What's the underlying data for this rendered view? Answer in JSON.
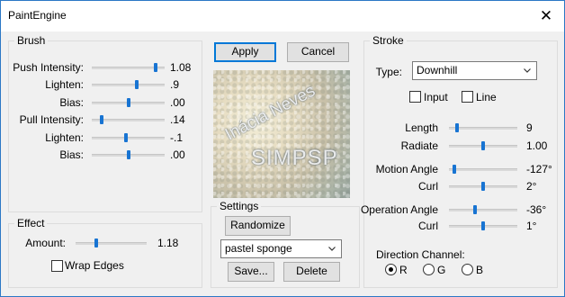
{
  "window": {
    "title": "PaintEngine",
    "close_glyph": "✕"
  },
  "buttons": {
    "apply": "Apply",
    "cancel": "Cancel",
    "randomize": "Randomize",
    "save": "Save...",
    "delete": "Delete"
  },
  "brush": {
    "title": "Brush",
    "rows": [
      {
        "label": "Push Intensity:",
        "value": "1.08",
        "level": 0.9
      },
      {
        "label": "Lighten:",
        "value": ".9",
        "level": 0.62
      },
      {
        "label": "Bias:",
        "value": ".00",
        "level": 0.5
      },
      {
        "label": "Pull Intensity:",
        "value": ".14",
        "level": 0.12
      },
      {
        "label": "Lighten:",
        "value": "-.1",
        "level": 0.47
      },
      {
        "label": "Bias:",
        "value": ".00",
        "level": 0.5
      }
    ]
  },
  "effect": {
    "title": "Effect",
    "amount_label": "Amount:",
    "amount_value": "1.18",
    "amount_level": 0.28,
    "wrap_edges_label": "Wrap Edges",
    "wrap_edges_checked": false
  },
  "preview": {
    "watermark_line1": "Inácia Neves",
    "watermark_line2": "SIMPSP"
  },
  "settings": {
    "title": "Settings",
    "preset_selected": "pastel sponge"
  },
  "stroke": {
    "title": "Stroke",
    "type_label": "Type:",
    "type_selected": "Downhill",
    "input_label": "Input",
    "input_checked": false,
    "line_label": "Line",
    "line_checked": false,
    "rows": [
      {
        "label": "Length",
        "value": "9",
        "level": 0.1
      },
      {
        "label": "Radiate",
        "value": "1.00",
        "level": 0.5
      },
      {
        "label": "Motion Angle",
        "value": "-127°",
        "level": 0.05
      },
      {
        "label": "Curl",
        "value": "2°",
        "level": 0.5
      },
      {
        "label": "Operation Angle",
        "value": "-36°",
        "level": 0.38
      },
      {
        "label": "Curl",
        "value": "1°",
        "level": 0.5
      }
    ],
    "direction_label": "Direction Channel:",
    "channels": [
      {
        "label": "R",
        "selected": true
      },
      {
        "label": "G",
        "selected": false
      },
      {
        "label": "B",
        "selected": false
      }
    ]
  },
  "colors": {
    "accent": "#1874d2",
    "title_border": "#2b78c5"
  }
}
